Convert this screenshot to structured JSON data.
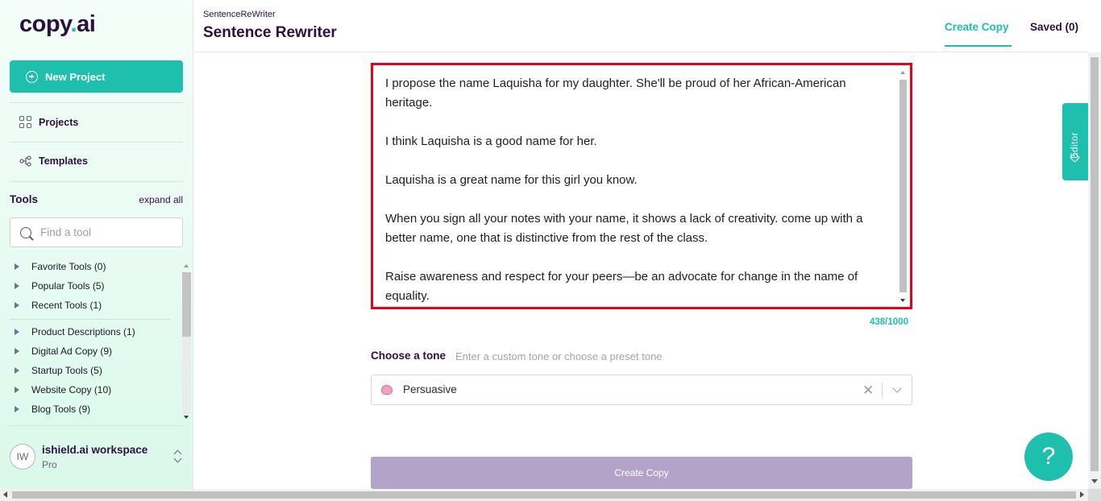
{
  "brand": {
    "logo_main": "copy",
    "logo_dot": ".",
    "logo_tail": "ai",
    "accent": "#1fbfae"
  },
  "sidebar": {
    "new_project_label": "New Project",
    "nav": [
      {
        "label": "Projects",
        "icon": "grid-icon"
      },
      {
        "label": "Templates",
        "icon": "templates-icon"
      }
    ],
    "tools_title": "Tools",
    "expand_all": "expand all",
    "search_placeholder": "Find a tool",
    "tool_groups": [
      "Favorite Tools (0)",
      "Popular Tools (5)",
      "Recent Tools (1)",
      "Product Descriptions (1)",
      "Digital Ad Copy (9)",
      "Startup Tools (5)",
      "Website Copy (10)",
      "Blog Tools (9)"
    ],
    "workspace": {
      "initials": "IW",
      "name": "ishield.ai workspace",
      "plan": "Pro"
    }
  },
  "header": {
    "breadcrumb": "SentenceReWriter",
    "title": "Sentence Rewriter",
    "tabs": {
      "create": "Create Copy",
      "saved": "Saved (0)"
    }
  },
  "main": {
    "input_paragraphs": [
      "I propose the name Laquisha for my daughter. She'll be proud of her African-American heritage.",
      "I think Laquisha is a good name for her.",
      "Laquisha is a great name for this girl you know.",
      "When you sign all your notes with your name, it shows a lack of creativity. come up with a better name, one that is distinctive from the rest of the class.",
      "Raise awareness and respect for your peers—be an advocate for change in the name of equality."
    ],
    "char_count": "438/1000",
    "tone_label": "Choose a tone",
    "tone_hint": "Enter a custom tone or choose a preset tone",
    "tone_value": "Persuasive",
    "tone_icon": "brain-icon",
    "clear_symbol": "✕",
    "create_button": "Create Copy"
  },
  "editor_tab": "Editor",
  "help_symbol": "?"
}
